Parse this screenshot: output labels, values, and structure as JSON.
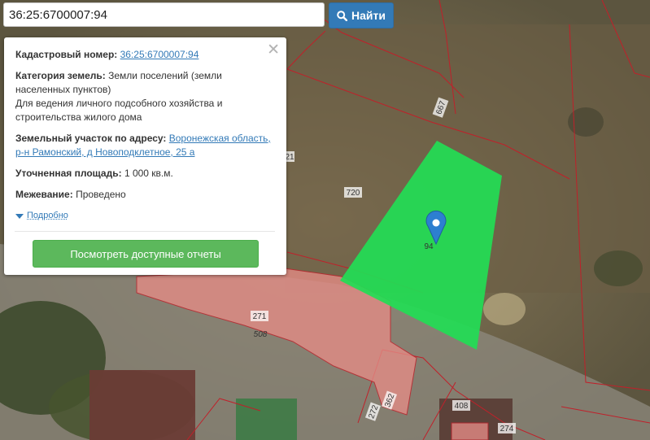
{
  "search": {
    "value": "36:25:6700007:94",
    "button_label": "Найти",
    "icon": "search-icon"
  },
  "info_panel": {
    "cadastral_label": "Кадастровый номер:",
    "cadastral_value": "36:25:6700007:94",
    "category_label": "Категория земель:",
    "category_value": "Земли поселений (земли населенных пунктов)",
    "purpose": "Для ведения личного подсобного хозяйства и строительства жилого дома",
    "address_label": "Земельный участок по адресу:",
    "address_value": "Воронежская область, р-н Рамонский, д Новоподклетное, 25 а",
    "area_label": "Уточненная площадь:",
    "area_value": "1 000 кв.м.",
    "survey_label": "Межевание:",
    "survey_value": "Проведено",
    "details_label": "Подробно",
    "reports_button": "Посмотреть доступные отчеты",
    "close_icon": "close-icon"
  },
  "map": {
    "highlight_color": "#22dd55",
    "selected_parcel_label": "94",
    "parcel_labels": [
      "667",
      "720",
      "21",
      "271",
      "508",
      "272",
      "362",
      "408",
      "274"
    ],
    "marker_icon": "map-pin-icon",
    "marker_color": "#2d7fd0"
  }
}
